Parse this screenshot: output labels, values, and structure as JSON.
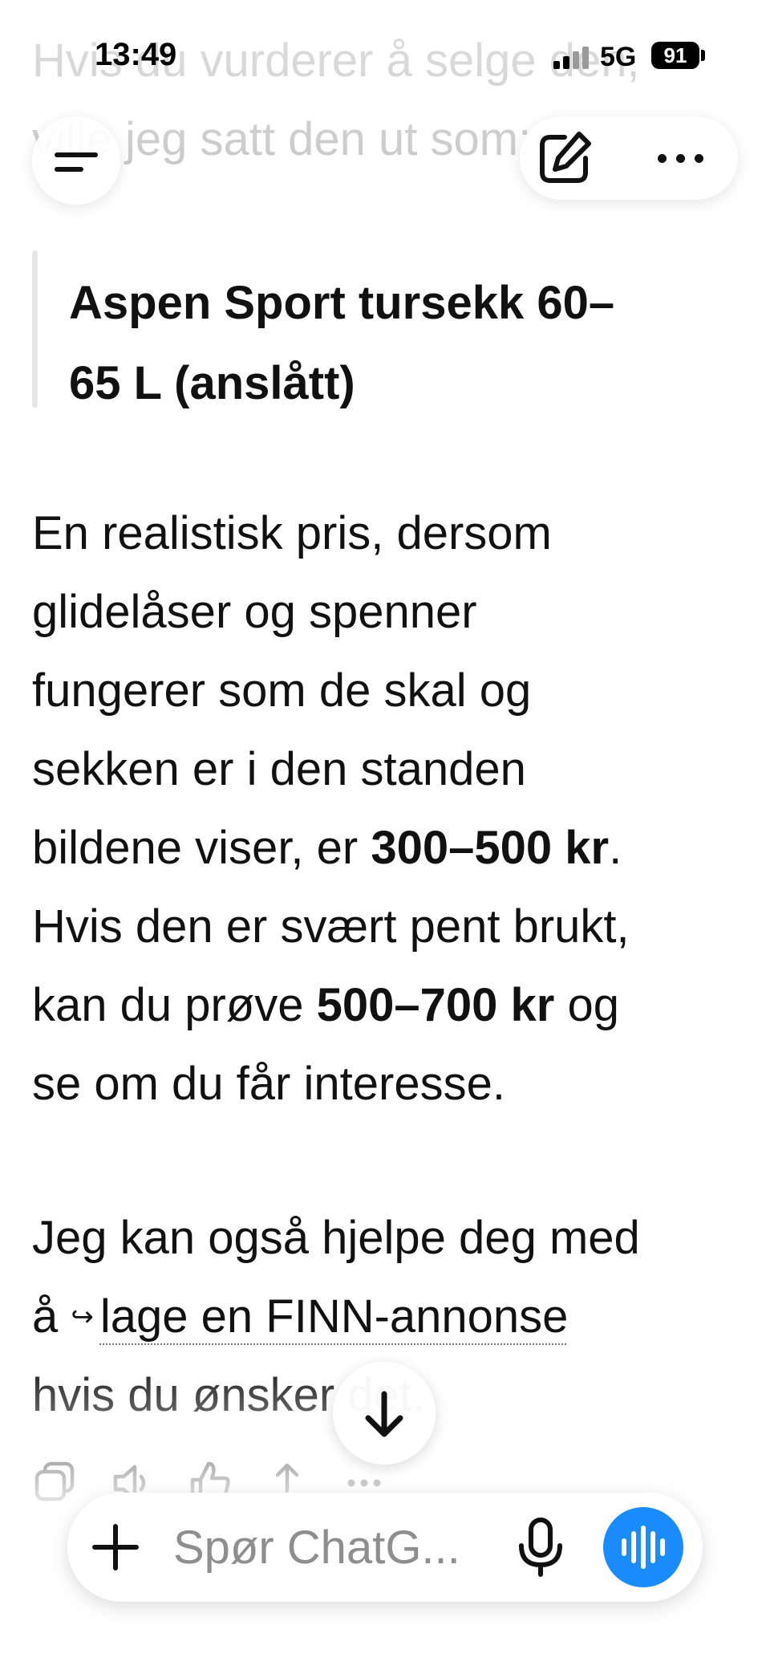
{
  "status_bar": {
    "time": "13:49",
    "network": "5G",
    "battery": "91"
  },
  "faded_top": {
    "line1": "Hvis du vurderer å selge den,",
    "line2": "ville jeg satt den ut som:"
  },
  "message": {
    "quote_line1": "Aspen Sport tursekk 60–",
    "quote_line2": "65 L (anslått)",
    "p1_line1": "En realistisk pris, dersom",
    "p1_line2": "glidelåser og spenner",
    "p1_line3": "fungerer som de skal og",
    "p1_line4": "sekken er i den standen",
    "p1_line5_pre": "bildene viser, er ",
    "p1_line5_bold": "300–500 kr",
    "p1_line5_post": ".",
    "p1_line6": "Hvis den er svært pent brukt,",
    "p1_line7_pre": "kan du prøve ",
    "p1_line7_bold": "500–700 kr",
    "p1_line7_post": " og",
    "p1_line8": "se om du får interesse.",
    "p2_line1": "Jeg kan også hjelpe deg med",
    "p2_line2_pre": "å ",
    "p2_link_arrow": "↪",
    "p2_link": "lage en FINN-annonse",
    "p2_line3": "hvis du ønsker det."
  },
  "composer": {
    "placeholder": "Spør ChatG..."
  },
  "icons": {
    "menu": "menu-icon",
    "edit": "new-chat-edit-icon",
    "more": "more-icon",
    "scroll": "arrow-down-icon",
    "plus": "plus-icon",
    "mic": "mic-icon",
    "voice": "voice-mode-icon"
  }
}
